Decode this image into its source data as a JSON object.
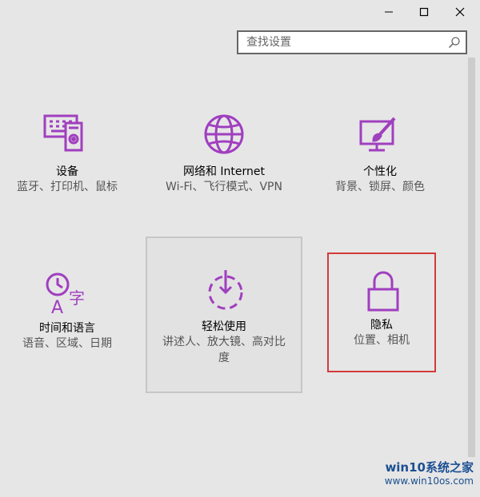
{
  "window_controls": {
    "minimize": "minimize-icon",
    "maximize": "maximize-icon",
    "close": "close-icon"
  },
  "search": {
    "placeholder": "查找设置",
    "icon": "search-icon"
  },
  "tiles": [
    {
      "title": "设备",
      "desc": "蓝牙、打印机、鼠标",
      "icon": "devices-icon"
    },
    {
      "title": "网络和 Internet",
      "desc": "Wi-Fi、飞行模式、VPN",
      "icon": "globe-icon"
    },
    {
      "title": "个性化",
      "desc": "背景、锁屏、颜色",
      "icon": "personalization-icon"
    },
    {
      "title": "时间和语言",
      "desc": "语音、区域、日期",
      "icon": "time-language-icon"
    },
    {
      "title": "轻松使用",
      "desc": "讲述人、放大镜、高对比度",
      "icon": "ease-of-access-icon"
    },
    {
      "title": "隐私",
      "desc": "位置、相机",
      "icon": "lock-icon"
    }
  ],
  "watermark": {
    "brand": "win10系统之家",
    "url": "www.win10os.com"
  },
  "colors": {
    "accent": "#a03fbf",
    "background": "#e6e6e6",
    "highlight_border": "#d33a3a"
  }
}
